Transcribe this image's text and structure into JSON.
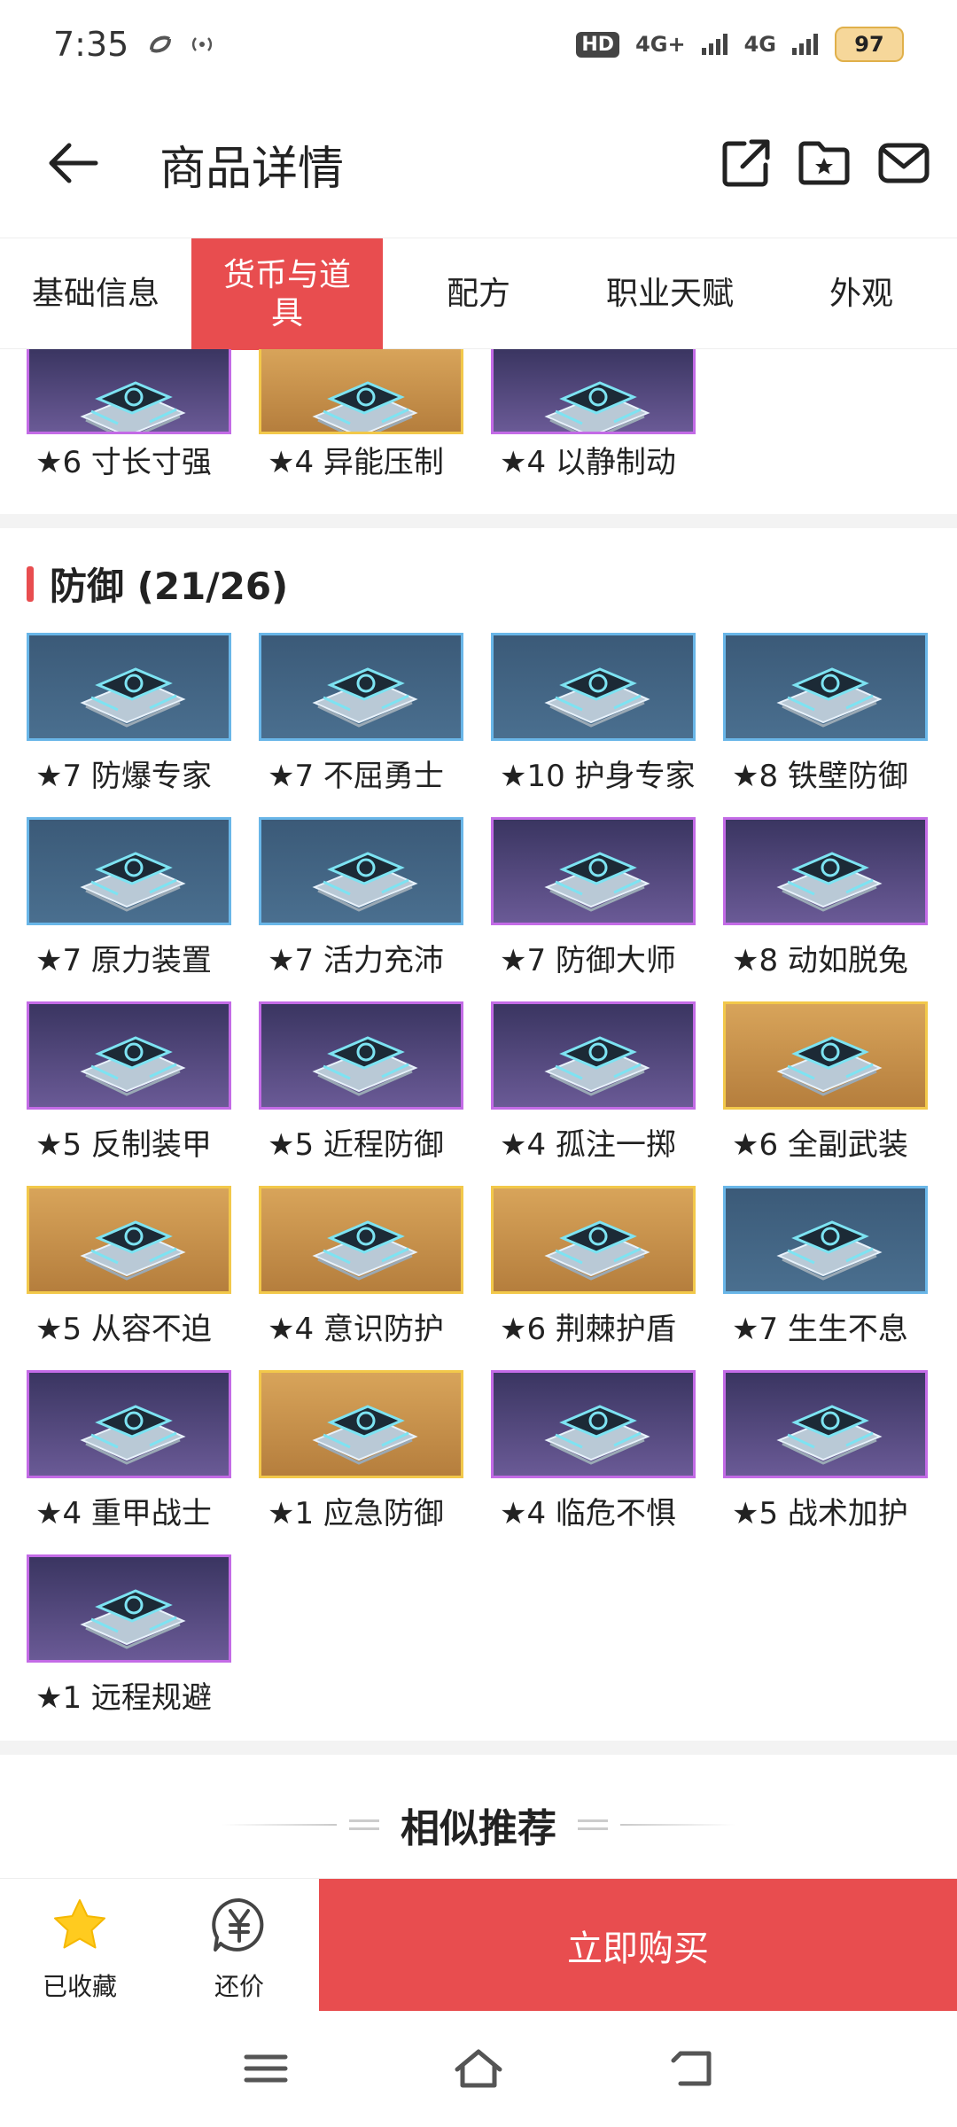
{
  "status": {
    "time": "7:35",
    "hd": "HD",
    "net1": "4G+",
    "net2": "4G",
    "battery": "97"
  },
  "header": {
    "title": "商品详情"
  },
  "tabs": [
    {
      "label": "基础信息",
      "active": false
    },
    {
      "label": "货币与道具",
      "active": true
    },
    {
      "label": "配方",
      "active": false
    },
    {
      "label": "职业天赋",
      "active": false
    },
    {
      "label": "外观",
      "active": false
    }
  ],
  "prev_items": [
    {
      "label": "★6 寸长寸强",
      "rarity": "purple"
    },
    {
      "label": "★4 异能压制",
      "rarity": "gold"
    },
    {
      "label": "★4 以静制动",
      "rarity": "purple"
    }
  ],
  "defense": {
    "title": "防御 (21/26)",
    "items": [
      {
        "label": "★7 防爆专家",
        "rarity": "blue"
      },
      {
        "label": "★7 不屈勇士",
        "rarity": "blue"
      },
      {
        "label": "★10 护身专家",
        "rarity": "blue"
      },
      {
        "label": "★8 铁壁防御",
        "rarity": "blue"
      },
      {
        "label": "★7 原力装置",
        "rarity": "blue"
      },
      {
        "label": "★7 活力充沛",
        "rarity": "blue"
      },
      {
        "label": "★7 防御大师",
        "rarity": "purple"
      },
      {
        "label": "★8 动如脱兔",
        "rarity": "purple"
      },
      {
        "label": "★5 反制装甲",
        "rarity": "purple"
      },
      {
        "label": "★5 近程防御",
        "rarity": "purple"
      },
      {
        "label": "★4 孤注一掷",
        "rarity": "purple"
      },
      {
        "label": "★6 全副武装",
        "rarity": "gold"
      },
      {
        "label": "★5 从容不迫",
        "rarity": "gold"
      },
      {
        "label": "★4 意识防护",
        "rarity": "gold"
      },
      {
        "label": "★6 荆棘护盾",
        "rarity": "gold"
      },
      {
        "label": "★7 生生不息",
        "rarity": "blue"
      },
      {
        "label": "★4 重甲战士",
        "rarity": "purple"
      },
      {
        "label": "★1 应急防御",
        "rarity": "gold"
      },
      {
        "label": "★4 临危不惧",
        "rarity": "purple"
      },
      {
        "label": "★5 战术加护",
        "rarity": "purple"
      },
      {
        "label": "★1 远程规避",
        "rarity": "purple"
      }
    ]
  },
  "similar": {
    "title": "相似推荐"
  },
  "bottom": {
    "fav_label": "已收藏",
    "bargain_label": "还价",
    "buy_label": "立即购买"
  },
  "colors": {
    "accent": "#e84d4f",
    "rarity_blue": "#69b6e8",
    "rarity_purple": "#c36be6",
    "rarity_gold": "#f2c84a"
  }
}
